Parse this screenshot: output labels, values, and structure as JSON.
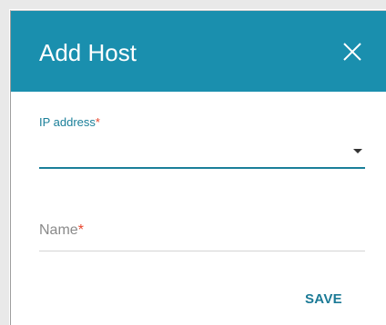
{
  "dialog": {
    "title": "Add Host",
    "close_icon": "close-icon"
  },
  "fields": {
    "ip_address": {
      "label": "IP address",
      "required_mark": "*",
      "value": "",
      "dropdown_icon": "dropdown-arrow-icon"
    },
    "name": {
      "placeholder": "Name",
      "required_mark": "*",
      "value": ""
    }
  },
  "actions": {
    "save_label": "SAVE"
  },
  "colors": {
    "header": "#1a8fae",
    "accent": "#1a7f99",
    "required": "#e8452c",
    "save": "#1b7a96"
  }
}
